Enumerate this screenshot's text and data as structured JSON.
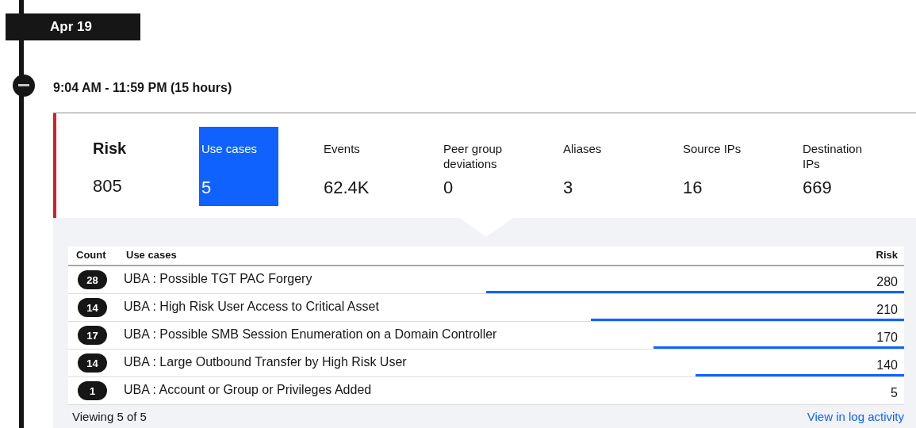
{
  "date_label": "Apr 19",
  "period": {
    "expanded": true,
    "title": "9:04 AM - 11:59 PM (15 hours)"
  },
  "risk": {
    "label": "Risk",
    "value": "805"
  },
  "tabs": [
    {
      "label": "Use cases",
      "value": "5",
      "selected": true
    },
    {
      "label": "Events",
      "value": "62.4K",
      "selected": false
    },
    {
      "label": "Peer group deviations",
      "value": "0",
      "selected": false
    },
    {
      "label": "Aliases",
      "value": "3",
      "selected": false
    },
    {
      "label": "Source IPs",
      "value": "16",
      "selected": false
    },
    {
      "label": "Destination IPs",
      "value": "669",
      "selected": false
    }
  ],
  "table": {
    "columns": [
      "Count",
      "Use cases",
      "Risk"
    ],
    "rows": [
      {
        "count": "28",
        "use_case": "UBA : Possible TGT PAC Forgery",
        "risk": "280",
        "level": 0.5
      },
      {
        "count": "14",
        "use_case": "UBA : High Risk User Access to Critical Asset",
        "risk": "210",
        "level": 0.375
      },
      {
        "count": "17",
        "use_case": "UBA : Possible SMB Session Enumeration on a Domain Controller",
        "risk": "170",
        "level": 0.3
      },
      {
        "count": "14",
        "use_case": "UBA : Large Outbound Transfer by High Risk User",
        "risk": "140",
        "level": 0.25
      },
      {
        "count": "1",
        "use_case": "UBA : Account or Group or Privileges Added",
        "risk": "5",
        "level": 0
      }
    ]
  },
  "footer": {
    "viewing": "Viewing 5 of 5",
    "link": "View in log activity"
  }
}
